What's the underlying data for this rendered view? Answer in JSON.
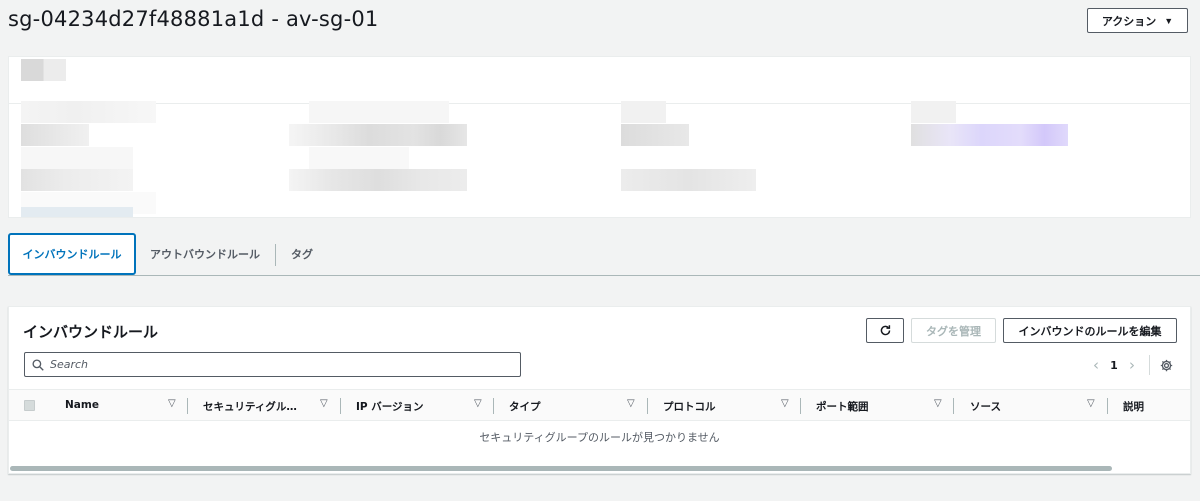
{
  "header": {
    "title": "sg-04234d27f48881a1d - av-sg-01",
    "actions_label": "アクション",
    "actions_caret": "▼"
  },
  "tabs": [
    {
      "label": "インバウンドルール",
      "active": true
    },
    {
      "label": "アウトバウンドルール",
      "active": false
    },
    {
      "label": "タグ",
      "active": false
    }
  ],
  "rules": {
    "title": "インバウンドルール",
    "manage_tags_label": "タグを管理",
    "edit_label": "インバウンドのルールを編集",
    "search_placeholder": "Search",
    "pager": {
      "page": "1",
      "prev": "‹",
      "next": "›"
    },
    "columns": [
      "Name",
      "セキュリティグル…",
      "IP バージョン",
      "タイプ",
      "プロトコル",
      "ポート範囲",
      "ソース",
      "説明"
    ],
    "empty_message": "セキュリティグループのルールが見つかりません"
  },
  "colors": {
    "accent": "#0073bb",
    "text": "#16191f",
    "muted": "#545b64",
    "background": "#f2f3f3",
    "redaction_highlight": "#dcd6fb"
  },
  "icons": [
    "refresh-icon",
    "search-icon",
    "settings-gear-icon",
    "sort-caret-icon"
  ]
}
